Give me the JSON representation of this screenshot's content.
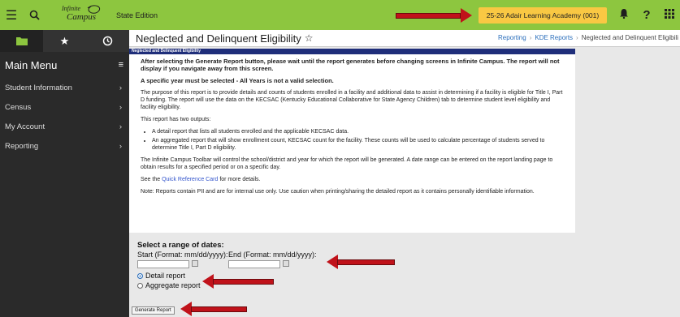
{
  "topbar": {
    "logo_line1": "Infinite",
    "logo_line2": "Campus",
    "edition": "State Edition",
    "school": "25-26 Adair Learning Academy (001)"
  },
  "sidebar": {
    "title": "Main Menu",
    "items": [
      {
        "label": "Student Information"
      },
      {
        "label": "Census"
      },
      {
        "label": "My Account"
      },
      {
        "label": "Reporting"
      }
    ]
  },
  "header": {
    "title": "Neglected and Delinquent Eligibility",
    "breadcrumb": [
      "Reporting",
      "KDE Reports",
      "Neglected and Delinquent Eligibili"
    ]
  },
  "panel": {
    "heading": "Neglected and Delinquent Eligibility",
    "warning": "After selecting the Generate Report button, please wait until the report generates before changing screens in Infinite Campus. The report will not display if you navigate away from this screen.",
    "year_note": "A specific year must be selected - All Years is not a valid selection.",
    "purpose": "The purpose of this report is to provide details and counts of students enrolled in a facility and additional data to assist in determining if a facility is eligible for Title I, Part D funding. The report will use the data on the KECSAC (Kentucky Educational Collaborative for State Agency Children) tab to determine student level eligibility and facility eligibility.",
    "outputs_intro": "This report has two outputs:",
    "outputs": [
      "A detail report that lists all students enrolled and the applicable KECSAC data.",
      "An aggregated report that will show enrollment count, KECSAC count for the facility. These counts will be used to calculate percentage of students served to determine Title I, Part D eligibility."
    ],
    "toolbar_note": "The Infinite Campus Toolbar will control the school/district and year for which the report will be generated. A date range can be entered on the report landing page to obtain results for a specified period or on a specific day.",
    "see_pre": "See the",
    "see_link": "Quick Reference Card",
    "see_post": "for more details.",
    "pii_note": "Note: Reports contain PII and are for internal use only. Use caution when printing/sharing the detailed report as it contains personally identifiable information."
  },
  "form": {
    "heading": "Select a range of dates:",
    "start_label": "Start (Format: mm/dd/yyyy):",
    "end_label": "End (Format: mm/dd/yyyy):",
    "start_value": "",
    "end_value": "",
    "radio_detail": "Detail report",
    "radio_aggregate": "Aggregate report",
    "selected": "Detail report",
    "generate": "Generate Report"
  },
  "colors": {
    "topbar": "#8dc63f",
    "school_badge": "#f9c843",
    "sidebar": "#2a2a2a",
    "panel_header": "#1f2e7a",
    "arrow": "#c0121a"
  }
}
